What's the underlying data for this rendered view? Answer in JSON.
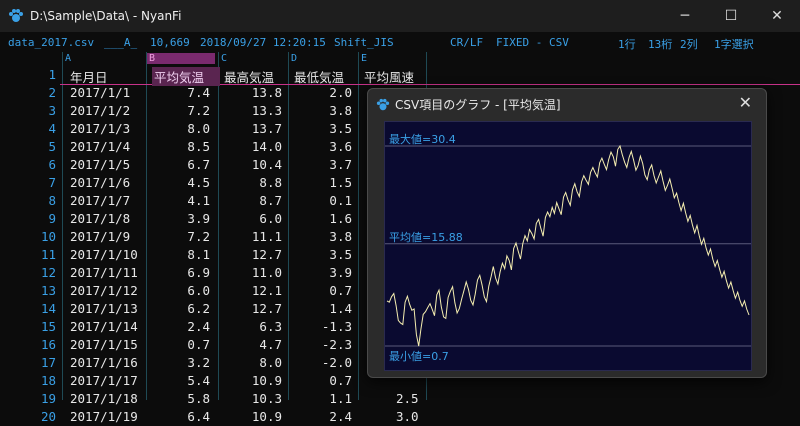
{
  "window": {
    "title": "D:\\Sample\\Data\\ - NyanFi",
    "minimize": "─",
    "maximize": "☐",
    "close": "✕"
  },
  "infobar": {
    "filename": "data_2017.csv",
    "marker": "___A_",
    "filesize": "10,669",
    "datetime": "2018/09/27 12:20:15",
    "encoding": "Shift_JIS",
    "linebreak": "CR/LF",
    "mode": "FIXED - CSV",
    "line": "1行",
    "column": "13桁",
    "column_index": "2列",
    "selection": "1字選択"
  },
  "columns": [
    "A",
    "B",
    "C",
    "D",
    "E"
  ],
  "headers": [
    "年月日",
    "平均気温",
    "最高気温",
    "最低気温",
    "平均風速"
  ],
  "rows": [
    {
      "n": "1"
    },
    {
      "n": "2",
      "a": "2017/1/1",
      "b": "7.4",
      "c": "13.8",
      "d": "2.0"
    },
    {
      "n": "3",
      "a": "2017/1/2",
      "b": "7.2",
      "c": "13.3",
      "d": "3.8"
    },
    {
      "n": "4",
      "a": "2017/1/3",
      "b": "8.0",
      "c": "13.7",
      "d": "3.5"
    },
    {
      "n": "5",
      "a": "2017/1/4",
      "b": "8.5",
      "c": "14.0",
      "d": "3.6"
    },
    {
      "n": "6",
      "a": "2017/1/5",
      "b": "6.7",
      "c": "10.4",
      "d": "3.7"
    },
    {
      "n": "7",
      "a": "2017/1/6",
      "b": "4.5",
      "c": "8.8",
      "d": "1.5"
    },
    {
      "n": "8",
      "a": "2017/1/7",
      "b": "4.1",
      "c": "8.7",
      "d": "0.1"
    },
    {
      "n": "9",
      "a": "2017/1/8",
      "b": "3.9",
      "c": "6.0",
      "d": "1.6"
    },
    {
      "n": "10",
      "a": "2017/1/9",
      "b": "7.2",
      "c": "11.1",
      "d": "3.8"
    },
    {
      "n": "11",
      "a": "2017/1/10",
      "b": "8.1",
      "c": "12.7",
      "d": "3.5"
    },
    {
      "n": "12",
      "a": "2017/1/11",
      "b": "6.9",
      "c": "11.0",
      "d": "3.9"
    },
    {
      "n": "13",
      "a": "2017/1/12",
      "b": "6.0",
      "c": "12.1",
      "d": "0.7"
    },
    {
      "n": "14",
      "a": "2017/1/13",
      "b": "6.2",
      "c": "12.7",
      "d": "1.4"
    },
    {
      "n": "15",
      "a": "2017/1/14",
      "b": "2.4",
      "c": "6.3",
      "d": "-1.3"
    },
    {
      "n": "16",
      "a": "2017/1/15",
      "b": "0.7",
      "c": "4.7",
      "d": "-2.3"
    },
    {
      "n": "17",
      "a": "2017/1/16",
      "b": "3.2",
      "c": "8.0",
      "d": "-2.0"
    },
    {
      "n": "18",
      "a": "2017/1/17",
      "b": "5.4",
      "c": "10.9",
      "d": "0.7"
    },
    {
      "n": "19",
      "a": "2017/1/18",
      "b": "5.8",
      "c": "10.3",
      "d": "1.1",
      "e": "2.5"
    },
    {
      "n": "20",
      "a": "2017/1/19",
      "b": "6.4",
      "c": "10.9",
      "d": "2.4",
      "e": "3.0"
    }
  ],
  "dialog": {
    "title": "CSV項目のグラフ - [平均気温]",
    "close": "✕",
    "max_label": "最大値=30.4",
    "avg_label": "平均値=15.88",
    "min_label": "最小値=0.7"
  },
  "colors": {
    "accent": "#3aa0e6",
    "line": "#f5eeb0",
    "plot_bg": "#0a0a30",
    "header_underline": "#c8328a"
  },
  "chart_data": {
    "type": "line",
    "series": [
      {
        "values": [
          7.4,
          7.2,
          8.0,
          8.5,
          6.7,
          4.5,
          4.1,
          3.9,
          7.2,
          8.1,
          6.9,
          6.0,
          6.2,
          2.4,
          0.7,
          3.2,
          5.4,
          5.8,
          6.4,
          7.0,
          6.1,
          5.2,
          8.3,
          9.0,
          6.5,
          5.0,
          4.8,
          7.9,
          8.8,
          9.5,
          7.1,
          5.6,
          6.3,
          7.7,
          8.9,
          10.2,
          9.1,
          7.5,
          6.8,
          8.4,
          10.5,
          11.2,
          9.8,
          8.0,
          7.3,
          9.6,
          11.0,
          12.5,
          10.8,
          9.9,
          11.7,
          13.0,
          12.2,
          14.1,
          13.4,
          12.0,
          15.2,
          16.0,
          14.8,
          13.6,
          15.9,
          17.1,
          16.3,
          18.0,
          17.4,
          16.6,
          18.9,
          19.5,
          18.2,
          17.0,
          19.8,
          20.6,
          19.9,
          21.3,
          20.4,
          22.0,
          21.1,
          20.2,
          22.8,
          23.5,
          22.4,
          21.6,
          23.9,
          24.8,
          23.6,
          22.9,
          25.1,
          26.0,
          25.3,
          24.7,
          26.5,
          27.2,
          26.4,
          25.8,
          27.9,
          28.6,
          27.7,
          26.9,
          28.4,
          29.5,
          28.8,
          27.4,
          29.9,
          30.4,
          29.1,
          28.0,
          27.2,
          28.7,
          29.6,
          28.3,
          26.8,
          27.5,
          28.9,
          27.8,
          26.1,
          25.4,
          26.9,
          27.6,
          26.0,
          24.9,
          25.8,
          26.7,
          25.2,
          23.8,
          24.6,
          25.5,
          24.1,
          22.7,
          23.4,
          22.0,
          20.8,
          21.9,
          20.5,
          19.2,
          20.1,
          18.7,
          17.5,
          18.6,
          17.1,
          15.8,
          16.7,
          15.3,
          14.2,
          15.1,
          13.6,
          12.5,
          13.4,
          12.1,
          10.9,
          11.8,
          10.4,
          9.3,
          10.2,
          8.9,
          7.8,
          8.7,
          7.5,
          6.6,
          7.4,
          6.2,
          5.3
        ]
      }
    ],
    "max": 30.4,
    "mean": 15.88,
    "min": 0.7
  }
}
